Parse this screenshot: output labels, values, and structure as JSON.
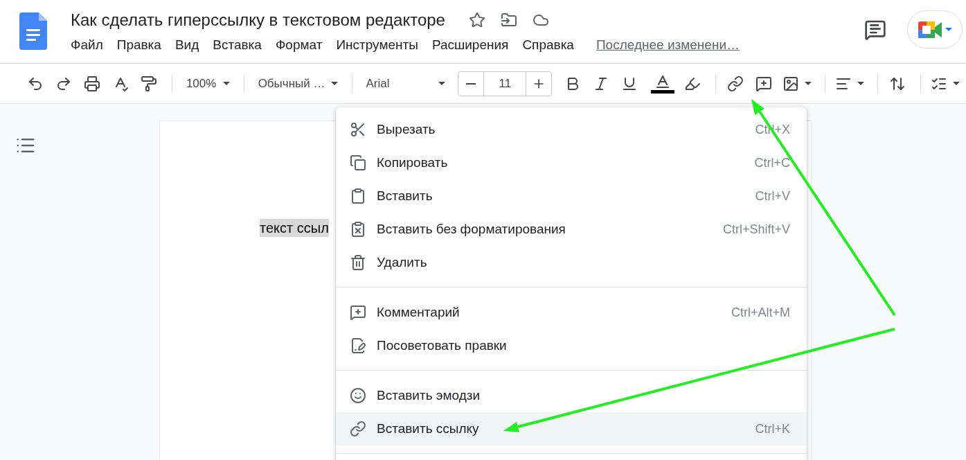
{
  "document": {
    "title": "Как сделать гиперссылку в текстовом редакторе",
    "last_edit": "Последнее изменени…",
    "body_text": "текст ссыл"
  },
  "menubar": [
    "Файл",
    "Правка",
    "Вид",
    "Вставка",
    "Формат",
    "Инструменты",
    "Расширения",
    "Справка"
  ],
  "toolbar": {
    "zoom": "100%",
    "style": "Обычный …",
    "font": "Arial",
    "font_size": "11"
  },
  "context_menu": [
    [
      {
        "kind": "cut",
        "label": "Вырезать",
        "shortcut": "Ctrl+X",
        "selected": false
      },
      {
        "kind": "copy",
        "label": "Копировать",
        "shortcut": "Ctrl+C",
        "selected": false
      },
      {
        "kind": "paste",
        "label": "Вставить",
        "shortcut": "Ctrl+V",
        "selected": false
      },
      {
        "kind": "paste-plain",
        "label": "Вставить без форматирования",
        "shortcut": "Ctrl+Shift+V",
        "selected": false
      },
      {
        "kind": "delete",
        "label": "Удалить",
        "selected": false
      }
    ],
    [
      {
        "kind": "comment",
        "label": "Комментарий",
        "shortcut": "Ctrl+Alt+M",
        "selected": false
      },
      {
        "kind": "suggest",
        "label": "Посоветовать правки",
        "selected": false
      }
    ],
    [
      {
        "kind": "emoji",
        "label": "Вставить эмодзи",
        "selected": false
      },
      {
        "kind": "link",
        "label": "Вставить ссылку",
        "shortcut": "Ctrl+K",
        "selected": true
      }
    ]
  ]
}
